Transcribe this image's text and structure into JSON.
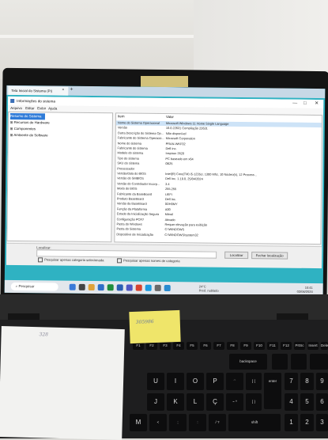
{
  "browser_tab": {
    "title": "Tela Inicial do Sistema (Pi)",
    "close": "×",
    "new_tab": "+"
  },
  "window": {
    "title": "Informações do sistema",
    "controls": [
      "—",
      "□",
      "✕"
    ],
    "menu": [
      "Arquivo",
      "Editar",
      "Exibir",
      "Ajuda"
    ]
  },
  "tree": [
    {
      "label": "Resumo do Sistema",
      "selected": true
    },
    {
      "label": "⊞ Recursos de Hardware",
      "selected": false
    },
    {
      "label": "⊞ Componentes",
      "selected": false
    },
    {
      "label": "⊞ Ambiente de Software",
      "selected": false
    }
  ],
  "details": {
    "col_item": "Item",
    "col_value": "Valor",
    "rows": [
      {
        "k": "Nome do Sistema Operacional",
        "v": "Microsoft Windows 11 Home Single Language",
        "hl": true
      },
      {
        "k": "Versão",
        "v": "10.0.22631 Compilação 22631"
      },
      {
        "k": "Outra Descrição do Sistema Op...",
        "v": "Não disponível"
      },
      {
        "k": "Fabricante do Sistema Operacio...",
        "v": "Microsoft Corporation"
      },
      {
        "k": "Nome do sistema",
        "v": "PRAN-WKF02"
      },
      {
        "k": "Fabricante do sistema",
        "v": "Dell Inc."
      },
      {
        "k": "Modelo do sistema",
        "v": "Inspiron 3520"
      },
      {
        "k": "Tipo do sistema",
        "v": "PC baseado em x64"
      },
      {
        "k": "SKU do sistema",
        "v": "0B25"
      },
      {
        "k": "Processador",
        "v": ""
      },
      {
        "k": "Versão/data do BIOS",
        "v": "Intel(R) Core(TM) i5-1235U, 1300 Mhz, 10 Núcleo(s), 12 Process..."
      },
      {
        "k": "Versão do SMBIOS",
        "v": "Dell Inc. 1.19.0, 25/04/2024"
      },
      {
        "k": "Versão do Controlador Incorp...",
        "v": "3.4"
      },
      {
        "k": "Modo do BIOS",
        "v": "255.255"
      },
      {
        "k": "Fabricante da BaseBoard",
        "v": "UEFI"
      },
      {
        "k": "Produto BaseBoard",
        "v": "Dell Inc."
      },
      {
        "k": "Versão da BaseBoard",
        "v": "0DH0MY"
      },
      {
        "k": "Função da Plataforma",
        "v": "A00"
      },
      {
        "k": "Estado da Inicialização Segura",
        "v": "Móvel"
      },
      {
        "k": "Configuração PCR7",
        "v": "Ativado"
      },
      {
        "k": "Pasta do Windows",
        "v": "Requer elevação para exibição"
      },
      {
        "k": "Pasta do Sistema",
        "v": "C:\\WINDOWS"
      },
      {
        "k": "Dispositivo de Inicialização",
        "v": "C:\\WINDOWS\\system32"
      }
    ]
  },
  "findbar": {
    "label": "Localizar:",
    "find_button": "Localizar",
    "close_button": "Fechar localização",
    "check1": "Pesquisar apenas categoria selecionada",
    "check2": "Pesquisar apenas nomes de categoria"
  },
  "taskbar": {
    "search_placeholder": "Pesquisar",
    "weather_temp": "24°C",
    "weather_desc": "Pred. nublado",
    "time": "10:41",
    "date": "03/06/2024"
  },
  "sticky_note": "305986",
  "paper_note": "328",
  "keyboard": {
    "row1": [
      "F1",
      "F2",
      "F3",
      "F4",
      "F5",
      "F6",
      "F7",
      "F8",
      "F9",
      "F10",
      "F11",
      "F12",
      "PrtSc",
      "Insert",
      "Delete"
    ],
    "row_backspace": "backspace",
    "row2": [
      "U",
      "I",
      "O",
      "P",
      "´`",
      "[ {",
      "enter",
      "7",
      "8",
      "9"
    ],
    "row3": [
      "J",
      "K",
      "L",
      "Ç",
      "~ ^",
      "] }",
      "4",
      "5",
      "6"
    ],
    "row4": [
      "M",
      "<",
      ";",
      ":",
      "/ ?",
      "shift",
      "1",
      "2",
      "3"
    ]
  }
}
